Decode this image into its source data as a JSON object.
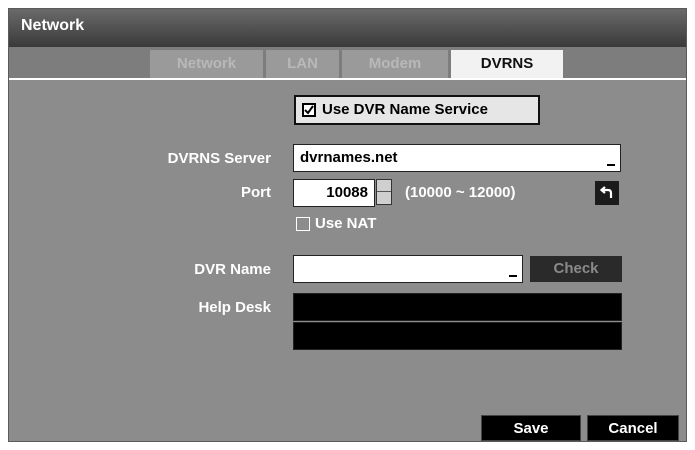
{
  "window": {
    "title": "Network"
  },
  "tabs": [
    {
      "label": "Network",
      "active": false
    },
    {
      "label": "LAN",
      "active": false
    },
    {
      "label": "Modem",
      "active": false
    },
    {
      "label": "DVRNS",
      "active": true
    }
  ],
  "form": {
    "use_dvrns": {
      "label": "Use DVR Name Service",
      "checked": true
    },
    "dvrns_server": {
      "label": "DVRNS Server",
      "value": "dvrnames.net"
    },
    "port": {
      "label": "Port",
      "value": "10088",
      "range": "(10000 ~ 12000)"
    },
    "use_nat": {
      "label": "Use NAT",
      "checked": false
    },
    "dvr_name": {
      "label": "DVR Name",
      "value": ""
    },
    "check_button": "Check",
    "help_desk": {
      "label": "Help Desk",
      "line1": "",
      "line2": ""
    }
  },
  "footer": {
    "save_label": "Save",
    "cancel_label": "Cancel"
  },
  "icons": {
    "undo": "undo-arrow-icon",
    "check": "checkmark-icon",
    "spin_up": "spin-up-icon",
    "spin_down": "spin-down-icon"
  }
}
